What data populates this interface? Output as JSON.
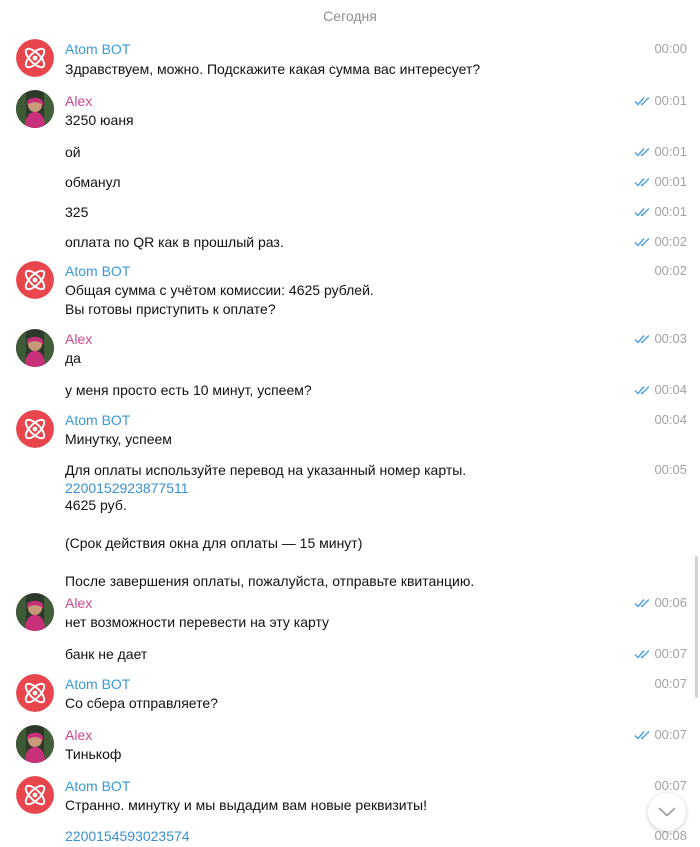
{
  "date_separator": "Сегодня",
  "colors": {
    "bot_name": "#3a9ad9",
    "user_name": "#d0458f",
    "link": "#3a8fd4",
    "time": "#a2a2a8",
    "read_ticks": "#4a9ee0",
    "bot_avatar": "#e8454c"
  },
  "authors": {
    "bot": "Atom BOT",
    "user": "Alex"
  },
  "messages": [
    {
      "author": "Atom BOT",
      "text": "Здравствуем, можно. Подскажите какая сумма вас интересует?",
      "time": "00:00",
      "read": false
    },
    {
      "author": "Alex",
      "text": "3250 юаня",
      "time": "00:01",
      "read": true
    },
    {
      "author": "Alex",
      "text": "ой",
      "time": "00:01",
      "read": true
    },
    {
      "author": "Alex",
      "text": "обманул",
      "time": "00:01",
      "read": true
    },
    {
      "author": "Alex",
      "text": "325",
      "time": "00:01",
      "read": true
    },
    {
      "author": "Alex",
      "text": "оплата по QR как в прошлый раз.",
      "time": "00:02",
      "read": true
    },
    {
      "author": "Atom BOT",
      "text": "Общая сумма с учётом комиссии: 4625 рублей.\nВы готовы приступить к оплате?",
      "time": "00:02",
      "read": false
    },
    {
      "author": "Alex",
      "text": "да",
      "time": "00:03",
      "read": true
    },
    {
      "author": "Alex",
      "text": "у меня просто есть 10 минут, успеем?",
      "time": "00:04",
      "read": true
    },
    {
      "author": "Atom BOT",
      "text": "Минутку, успеем",
      "time": "00:04",
      "read": false
    },
    {
      "author": "Atom BOT",
      "text_before": "Для оплаты используйте перевод на указанный номер карты.",
      "link": "2200152923877511",
      "text_after": "4625 руб.\n\n(Срок действия окна для оплаты — 15 минут)\n\nПосле завершения оплаты, пожалуйста, отправьте квитанцию.",
      "time": "00:05",
      "read": false
    },
    {
      "author": "Alex",
      "text": "нет возможности перевести на эту карту",
      "time": "00:06",
      "read": true
    },
    {
      "author": "Alex",
      "text": "банк не дает",
      "time": "00:07",
      "read": true
    },
    {
      "author": "Atom BOT",
      "text": "Со сбера отправляете?",
      "time": "00:07",
      "read": false
    },
    {
      "author": "Alex",
      "text": "Тинькоф",
      "time": "00:07",
      "read": true
    },
    {
      "author": "Atom BOT",
      "text": "Странно. минутку и мы выдадим вам новые реквизиты!",
      "time": "00:07",
      "read": false
    },
    {
      "author": "Atom BOT",
      "link": "2200154593023574",
      "time": "00:08",
      "read": false
    }
  ],
  "icons": {
    "bot_avatar": "atom-logo-icon",
    "user_avatar": "user-photo",
    "read_receipt": "double-check-icon",
    "scroll_down": "chevron-down-icon"
  }
}
